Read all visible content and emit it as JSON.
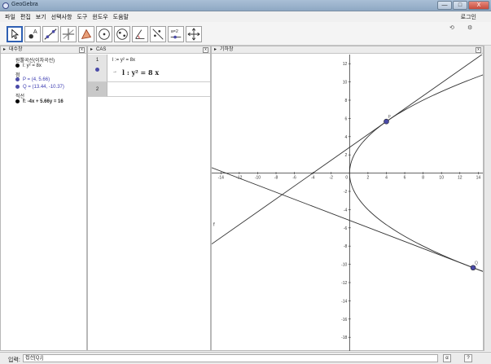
{
  "window": {
    "title": "GeoGebra",
    "minimize": "—",
    "maximize": "□",
    "close": "X"
  },
  "menu": [
    "파일",
    "편집",
    "보기",
    "선택사항",
    "도구",
    "윈도우",
    "도움말"
  ],
  "signin": "로그인",
  "toolbar_right": {
    "undo": "⟲",
    "settings": "⚙"
  },
  "tools": [
    {
      "name": "move-tool-icon",
      "selected": true
    },
    {
      "name": "point-tool-icon"
    },
    {
      "name": "line-tool-icon"
    },
    {
      "name": "perpendicular-tool-icon"
    },
    {
      "name": "polygon-tool-icon"
    },
    {
      "name": "circle-tool-icon"
    },
    {
      "name": "ellipse-tool-icon"
    },
    {
      "name": "angle-tool-icon"
    },
    {
      "name": "reflect-tool-icon"
    },
    {
      "name": "slider-tool-icon",
      "label": "a=2"
    },
    {
      "name": "move-graphics-tool-icon"
    }
  ],
  "algebra": {
    "title": "대수창",
    "items": [
      {
        "type": "header",
        "text": "원뿔곡선(이차곡선)"
      },
      {
        "type": "item",
        "text": "l: y² = 8x",
        "color": "#000000"
      },
      {
        "type": "header",
        "text": "점"
      },
      {
        "type": "item",
        "text": "P = (4, 5.66)",
        "color": "#3a3ab0"
      },
      {
        "type": "item",
        "text": "Q = (13.44, -10.37)",
        "color": "#3a3ab0"
      },
      {
        "type": "header",
        "text": "직선"
      },
      {
        "type": "item",
        "text": "f: -4x + 5.66y = 16",
        "color": "#000000"
      }
    ]
  },
  "cas": {
    "title": "CAS",
    "rows": [
      {
        "num": "1",
        "input": "l := y² = 8x",
        "output_arrow": "→",
        "output": "l :  y² = 8 x"
      },
      {
        "num": "2",
        "input": "",
        "output": ""
      }
    ]
  },
  "graphics": {
    "title": "기하창",
    "point_labels": {
      "P": "P",
      "Q": "Q",
      "line_f": "f"
    },
    "x_ticks": [
      -14,
      -12,
      -10,
      -8,
      -6,
      -4,
      -2,
      0,
      2,
      4,
      6,
      8,
      10,
      12,
      14
    ],
    "y_ticks": [
      12,
      10,
      8,
      6,
      4,
      2,
      -2,
      -4,
      -6,
      -8,
      -10,
      -12,
      -14,
      -16,
      -18
    ],
    "x_range": [
      -15,
      14.5
    ],
    "y_range": [
      -19.5,
      13
    ],
    "P": [
      4,
      5.66
    ],
    "Q": [
      13.44,
      -10.37
    ],
    "parabola_a": 8,
    "accent": "#4a4aa8"
  },
  "status": {
    "input_label": "입력:",
    "input_value": "접선[Q,l]",
    "btn1": "α",
    "btn2": "?"
  }
}
